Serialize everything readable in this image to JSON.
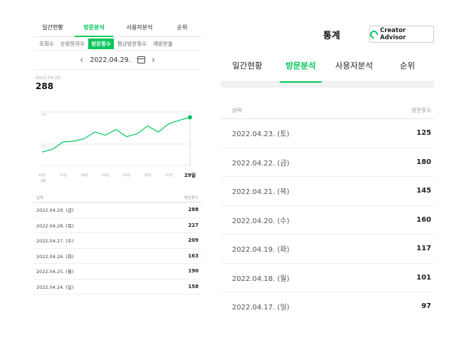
{
  "left": {
    "tabs": [
      {
        "label": "일간현황",
        "active": false
      },
      {
        "label": "방문분석",
        "active": true
      },
      {
        "label": "사용자분석",
        "active": false
      },
      {
        "label": "순위",
        "active": false
      }
    ],
    "subtabs": [
      {
        "label": "조회수",
        "active": false
      },
      {
        "label": "순방문자수",
        "active": false
      },
      {
        "label": "방문횟수",
        "active": true
      },
      {
        "label": "평균방문횟수",
        "active": false
      },
      {
        "label": "재방문율",
        "active": false
      }
    ],
    "date": "2022.04.29.",
    "summary_date": "2022.04.29.",
    "summary_value": "288",
    "table_header": {
      "date": "날짜",
      "count": "방문횟수"
    },
    "rows": [
      {
        "date": "2022.04.29. (금)",
        "count": "288"
      },
      {
        "date": "2022.04.28. (목)",
        "count": "227"
      },
      {
        "date": "2022.04.27. (수)",
        "count": "209"
      },
      {
        "date": "2022.04.26. (화)",
        "count": "163"
      },
      {
        "date": "2022.04.25. (월)",
        "count": "190"
      },
      {
        "date": "2022.04.24. (일)",
        "count": "158"
      }
    ]
  },
  "chart_data": {
    "type": "line",
    "x": [
      "15일",
      "16일",
      "17일",
      "18일",
      "19일",
      "20일",
      "21일",
      "22일",
      "23일",
      "24일",
      "25일",
      "26일",
      "27일",
      "28일",
      "29일"
    ],
    "tick_labels": [
      "15일",
      "17일",
      "19일",
      "21일",
      "23일",
      "25일",
      "27일",
      "29일"
    ],
    "x_note": "4월",
    "y_ticks": [
      "288",
      "144"
    ],
    "values": [
      80,
      97,
      141,
      145,
      160,
      200,
      181,
      215,
      172,
      190,
      236,
      200,
      250,
      270,
      288
    ],
    "ylim": [
      0,
      320
    ],
    "colors": {
      "line": "#03c75a",
      "grid": "#e4e4e4"
    }
  },
  "right": {
    "title": "통계",
    "badge": "Creator Advisor",
    "tabs": [
      {
        "label": "일간현황",
        "active": false
      },
      {
        "label": "방문분석",
        "active": true
      },
      {
        "label": "사용자분석",
        "active": false
      },
      {
        "label": "순위",
        "active": false
      }
    ],
    "table_header": {
      "date": "날짜",
      "count": "방문횟수"
    },
    "rows": [
      {
        "date": "2022.04.23. (토)",
        "count": "125"
      },
      {
        "date": "2022.04.22. (금)",
        "count": "180"
      },
      {
        "date": "2022.04.21. (목)",
        "count": "145"
      },
      {
        "date": "2022.04.20. (수)",
        "count": "160"
      },
      {
        "date": "2022.04.19. (화)",
        "count": "117"
      },
      {
        "date": "2022.04.18. (월)",
        "count": "101"
      },
      {
        "date": "2022.04.17. (일)",
        "count": "97"
      }
    ]
  }
}
